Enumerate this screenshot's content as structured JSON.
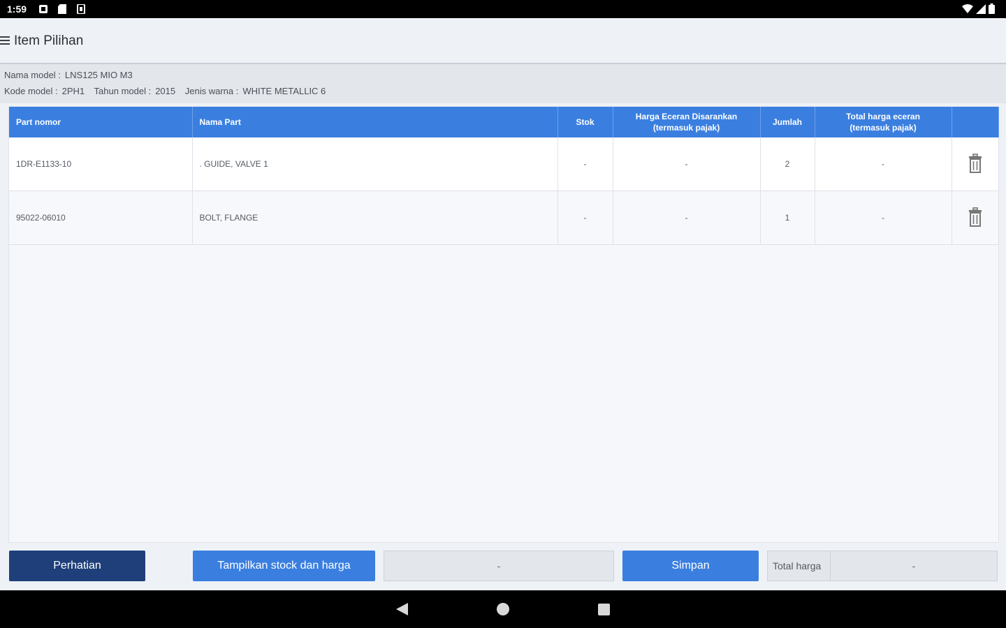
{
  "status_bar": {
    "time": "1:59"
  },
  "app_bar": {
    "title": "Item Pilihan"
  },
  "info": {
    "model_name_label": "Nama model :",
    "model_name": "LNS125 MIO M3",
    "model_code_label": "Kode model :",
    "model_code": "2PH1",
    "model_year_label": "Tahun model :",
    "model_year": "2015",
    "color_label": "Jenis warna :",
    "color": "WHITE METALLIC 6"
  },
  "table": {
    "headers": {
      "part_number": "Part nomor",
      "part_name": "Nama Part",
      "stock": "Stok",
      "retail_price_line1": "Harga Eceran Disarankan",
      "retail_price_line2": "(termasuk pajak)",
      "quantity": "Jumlah",
      "total_price_line1": "Total harga eceran",
      "total_price_line2": "(termasuk pajak)"
    },
    "rows": [
      {
        "part_number": "1DR-E1133-10",
        "part_name": ". GUIDE, VALVE 1",
        "stock": "-",
        "retail_price": "-",
        "quantity": "2",
        "total_price": "-"
      },
      {
        "part_number": "95022-06010",
        "part_name": "BOLT, FLANGE",
        "stock": "-",
        "retail_price": "-",
        "quantity": "1",
        "total_price": "-"
      }
    ]
  },
  "bottom": {
    "attention_button": "Perhatian",
    "show_stock_button": "Tampilkan stock dan harga",
    "middle_field_value": "-",
    "save_button": "Simpan",
    "total_label": "Total harga",
    "total_value": "-"
  },
  "colors": {
    "header_blue": "#3a7fe0",
    "dark_button": "#1f3f7a"
  },
  "icons": [
    "menu-icon",
    "trash-icon",
    "wifi-icon",
    "signal-icon",
    "battery-icon",
    "back-icon",
    "home-icon",
    "recents-icon"
  ]
}
